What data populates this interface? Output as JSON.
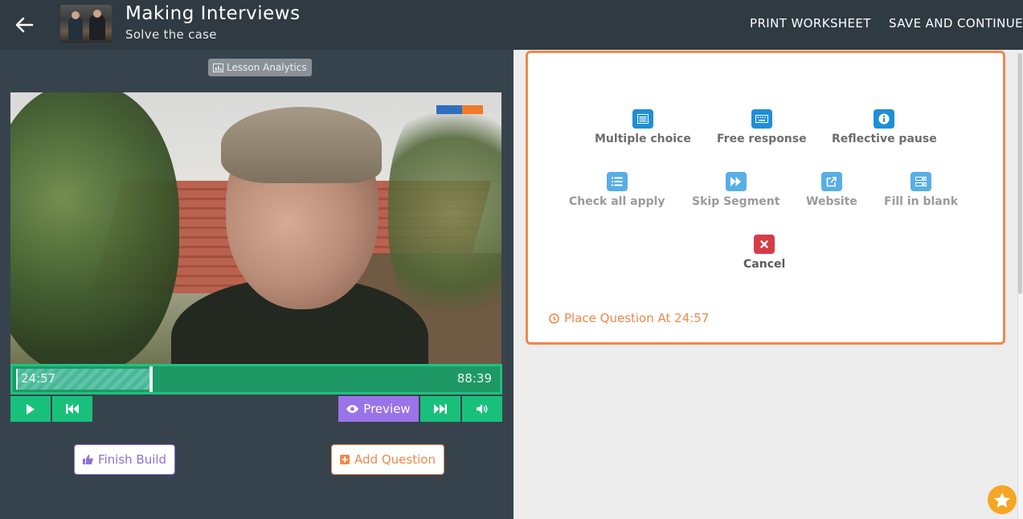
{
  "header": {
    "title": "Making Interviews",
    "subtitle": "Solve the case",
    "print_label": "PRINT WORKSHEET",
    "save_label": "SAVE AND CONTINUE",
    "background": "#2f3a42"
  },
  "left": {
    "analytics_label": "Lesson Analytics",
    "player": {
      "current_time": "24:57",
      "duration": "88:39",
      "played_fraction": 0.28,
      "preview_label": "Preview"
    },
    "finish_label": "Finish Build",
    "add_question_label": "Add Question"
  },
  "question_panel": {
    "types": [
      {
        "label": "Multiple choice",
        "icon": "list-icon"
      },
      {
        "label": "Free response",
        "icon": "keyboard-icon"
      },
      {
        "label": "Reflective pause",
        "icon": "info-icon"
      },
      {
        "label": "Check all apply",
        "icon": "checklist-icon"
      },
      {
        "label": "Skip Segment",
        "icon": "fast-forward-icon"
      },
      {
        "label": "Website",
        "icon": "external-link-icon"
      },
      {
        "label": "Fill in blank",
        "icon": "form-icon"
      }
    ],
    "cancel_label": "Cancel",
    "place_label": "Place Question At 24:57"
  },
  "colors": {
    "accent_orange": "#f0874a",
    "player_green": "#19c07b",
    "preview_purple": "#9b73e8",
    "icon_blue": "#1f8fd6",
    "cancel_red": "#d63c48"
  }
}
